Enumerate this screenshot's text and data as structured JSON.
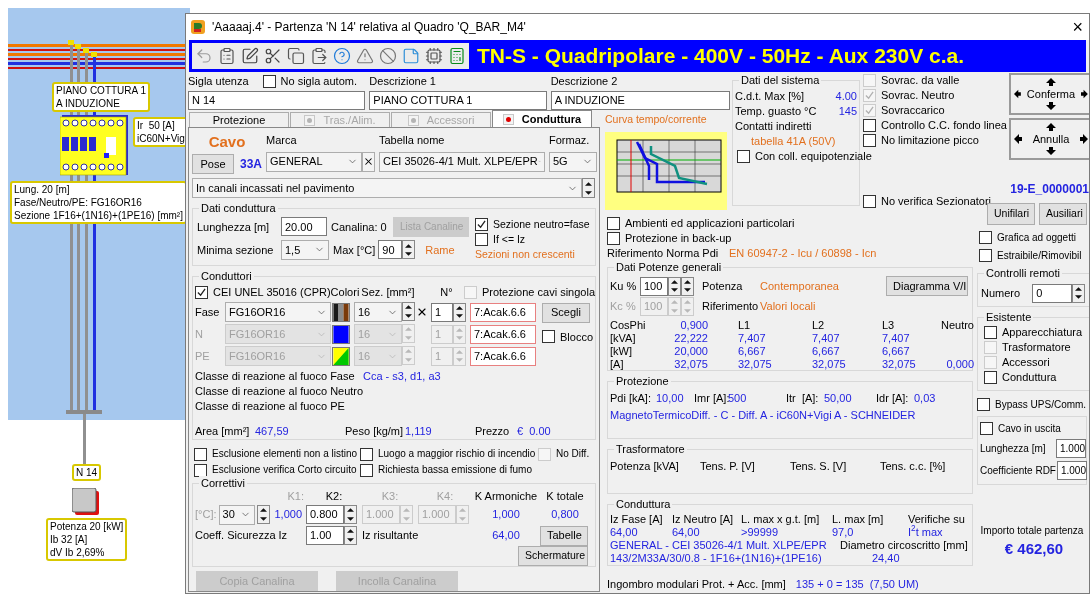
{
  "canvas": {
    "load_label": [
      "PIANO COTTURA 1",
      "A INDUZIONE"
    ],
    "breaker_label": [
      "Ir  50 [A]",
      "iC60N+Vig"
    ],
    "cable_label": [
      "Lung. 20 [m]",
      "Fase/Neutro/PE: FG16OR16",
      "Sezione 1F16+(1N16)+(1PE16) [mm²]"
    ],
    "node_label": "N 14",
    "load_info": [
      "Potenza 20 [kW]",
      "Ib 32 [A]",
      "dV Ib 2,69%"
    ]
  },
  "window": {
    "title": "'Aaaaaj.4' - Partenza 'N 14' relativa al Quadro 'Q_BAR_M4'",
    "close": "×"
  },
  "toolbar": {
    "banner": "TN-S - Quadripolare - 400V - 50Hz - Aux 230V c.a."
  },
  "header_fields": [
    {
      "label": "Sigla utenza",
      "value": "N 14",
      "checkbox": {
        "label": "No sigla autom.",
        "checked": false
      }
    },
    {
      "label": "Descrizione 1",
      "value": "PIANO COTTURA 1"
    },
    {
      "label": "Descrizione 2",
      "value": "A INDUZIONE"
    }
  ],
  "tabs": [
    {
      "label": "Protezione",
      "selected": false,
      "disabled": false
    },
    {
      "label": "Tras./Alim.",
      "selected": false,
      "disabled": true,
      "color": "#b4b4b4"
    },
    {
      "label": "Accessori",
      "selected": false,
      "disabled": true,
      "color": "#b4b4b4"
    },
    {
      "label": "Conduttura",
      "selected": true,
      "disabled": false,
      "color": "#e00000"
    }
  ],
  "cavo": {
    "title": "Cavo",
    "pose_button": "Pose",
    "current": "33A",
    "marca": {
      "label": "Marca",
      "value": "GENERAL"
    },
    "tabella": {
      "label": "Tabella nome",
      "value": "CEI 35026-4/1 Mult. XLPE/EPR"
    },
    "formaz": {
      "label": "Formaz.",
      "value": "5G"
    },
    "posa": "In canali incassati nel pavimento"
  },
  "dati_conduttura": {
    "title": "Dati conduttura",
    "lunghezza": {
      "label": "Lunghezza [m]",
      "value": "20.00"
    },
    "canalina": "Canalina: 0",
    "lista_button": {
      "label": "Lista Canaline",
      "disabled": true
    },
    "neutro_fase": {
      "label": "Sezione neutro=fase",
      "checked": true
    },
    "if_iz": {
      "label": "If <= Iz",
      "checked": false
    },
    "min_sezione": {
      "label": "Minima sezione",
      "value": "1,5"
    },
    "max_temp": {
      "label": "Max [°C]",
      "value": "90"
    },
    "material": "Rame",
    "warning": "Sezioni non crescenti"
  },
  "conduttori": {
    "title": "Conduttori",
    "cpr": {
      "label": "CEI UNEL 35016 (CPR)",
      "checked": true
    },
    "col_colori": "Colori",
    "col_sez": "Sez. [mm²]",
    "col_n": "N°",
    "protezione_singola": {
      "label": "Protezione cavi singola",
      "checked": false,
      "disabled": true
    },
    "rows": [
      {
        "label": "Fase",
        "cable": "FG16OR16",
        "sez": "16",
        "n": "1",
        "code": "7:Acak.6.6",
        "disabled": false,
        "clear": true,
        "stripes": [
          {
            "color": "#1a1a1a"
          },
          {
            "color": "#8c8c8c"
          },
          {
            "color": "#7a3a0a"
          }
        ]
      },
      {
        "label": "N",
        "cable": "FG16OR16",
        "sez": "16",
        "n": "1",
        "code": "7:Acak.6.6",
        "disabled": true,
        "clear": false,
        "stripes": [
          {
            "color": "#0000ff"
          }
        ]
      },
      {
        "label": "PE",
        "cable": "FG16OR16",
        "sez": "16",
        "n": "1",
        "code": "7:Acak.6.6",
        "disabled": true,
        "clear": false,
        "stripes": [
          {
            "color": "#ffff00"
          },
          {
            "color": "#00c800"
          }
        ]
      }
    ],
    "scegli": "Scegli",
    "blocco": {
      "label": "Blocco",
      "checked": false
    },
    "fire": [
      {
        "label": "Classe di reazione al fuoco Fase",
        "value": "Cca - s3, d1, a3"
      },
      {
        "label": "Classe di reazione al fuoco Neutro"
      },
      {
        "label": "Classe di reazione al fuoco PE"
      }
    ],
    "area": {
      "label": "Area [mm²]",
      "value": "467,59"
    },
    "peso": {
      "label": "Peso [kg/m]",
      "value": "1,119"
    },
    "prezzo": {
      "label": "Prezzo",
      "value": "€  0.00"
    }
  },
  "options": [
    {
      "label": "Esclusione elementi non a listino",
      "checked": false,
      "disabled": false
    },
    {
      "label": "Luogo a maggior rischio di incendio",
      "checked": false,
      "disabled": false
    },
    {
      "label": "No Diff.",
      "checked": false,
      "disabled": true
    },
    {
      "label": "Esclusione verifica Corto circuito",
      "checked": false,
      "disabled": false
    },
    {
      "label": "Richiesta bassa emissione di fumo",
      "checked": false,
      "disabled": false
    }
  ],
  "correttivi": {
    "title": "Correttivi",
    "temp_label": "[°C]:",
    "temp": "30",
    "k1": {
      "label": "K1:",
      "value": "1,000"
    },
    "k2": {
      "label": "K2:",
      "value": "0.800",
      "disabled": false
    },
    "k3": {
      "label": "K3:",
      "value": "1.000",
      "disabled": true
    },
    "k4": {
      "label": "K4:",
      "value": "1.000",
      "disabled": true
    },
    "k_armoniche": {
      "label": "K Armoniche",
      "value": "1,000"
    },
    "k_totale": {
      "label": "K totale",
      "value": "0,800"
    },
    "coeff": {
      "label": "Coeff. Sicurezza Iz",
      "value": "1.00"
    },
    "iz": {
      "label": "Iz risultante",
      "value": "64,00"
    },
    "tabelle": "Tabelle",
    "schermature": "Schermature"
  },
  "bottom_buttons": [
    {
      "label": "Copia Canalina",
      "disabled": true
    },
    {
      "label": "Incolla Canalina",
      "disabled": true
    }
  ],
  "curve": {
    "title": "Curva tempo/corrente"
  },
  "sistema": {
    "title": "Dati del sistema",
    "rows": [
      {
        "label": "C.d.t. Max [%]",
        "value": "4.00"
      },
      {
        "label": "Temp. guasto °C",
        "value": "145"
      }
    ],
    "contatti": "Contatti indiretti",
    "tabella": "tabella 41A (50V)",
    "equipotenziale": {
      "label": "Con coll. equipotenziale",
      "checked": false
    }
  },
  "flags": [
    {
      "label": "Sovrac. da valle",
      "checked": false,
      "disabled": true
    },
    {
      "label": "Sovrac. Neutro",
      "checked": true,
      "disabled": true
    },
    {
      "label": "Sovraccarico",
      "checked": true,
      "disabled": true
    },
    {
      "label": "Controllo C.C. fondo linea",
      "checked": false,
      "disabled": false
    },
    {
      "label": "No limitazione picco",
      "checked": false,
      "disabled": false
    }
  ],
  "no_verifica": {
    "label": "No verifica Sezionatori",
    "checked": false
  },
  "ambienti": [
    {
      "label": "Ambienti ed applicazioni particolari",
      "checked": false
    },
    {
      "label": "Protezione in back-up",
      "checked": false
    }
  ],
  "norma": {
    "label": "Riferimento Norma Pdi",
    "value": "EN 60947-2 - Icu / 60898 - Icn"
  },
  "potenze": {
    "title": "Dati Potenze generali",
    "ku": {
      "label": "Ku %",
      "value": "100",
      "disabled": false
    },
    "kc": {
      "label": "Kc %",
      "value": "100",
      "disabled": true
    },
    "potenza": {
      "label": "Potenza",
      "value": "Contemporanea"
    },
    "riferimento": {
      "label": "Riferimento",
      "value": "Valori locali"
    },
    "diagram_button": "Diagramma V/I",
    "header": {
      "label": "CosPhi",
      "value": "0,900",
      "columns": [
        "L1",
        "L2",
        "L3",
        "Neutro"
      ]
    },
    "rows": [
      {
        "label": "[kVA]",
        "values": [
          "22,222",
          "7,407",
          "7,407",
          "7,407"
        ]
      },
      {
        "label": "[kW]",
        "values": [
          "20,000",
          "6,667",
          "6,667",
          "6,667"
        ]
      },
      {
        "label": "[A]",
        "values": [
          "32,075",
          "32,075",
          "32,075",
          "32,075",
          "0,000"
        ]
      }
    ]
  },
  "protezione": {
    "title": "Protezione",
    "values": [
      {
        "label": "Pdi [kA]:",
        "value": "10,00"
      },
      {
        "label": "Imr [A]:",
        "value": "500"
      },
      {
        "label": "Itr  [A]:",
        "value": "50,00"
      },
      {
        "label": "Idr [A]:",
        "value": "0,03"
      }
    ],
    "description": "MagnetoTermicoDiff. - C - Diff. A - iC60N+Vigi A - SCHNEIDER"
  },
  "trasformatore": {
    "title": "Trasformatore",
    "columns": [
      "Potenza [kVA]",
      "Tens. P. [V]",
      "Tens. S. [V]",
      "Tens. c.c. [%]"
    ]
  },
  "conduttura": {
    "title": "Conduttura",
    "columns": [
      {
        "label": "Iz Fase [A]",
        "value": "64,00"
      },
      {
        "label": "Iz Neutro [A]",
        "value": "64,00"
      },
      {
        "label": "L. max x g.t. [m]",
        "value": ">99999"
      },
      {
        "label": "L. max [m]",
        "value": "97,0"
      },
      {
        "label": "Verifiche su",
        "value": "I$^{2}$t max"
      }
    ],
    "cable": "GENERAL - CEI 35026-4/1 Mult. XLPE/EPR",
    "code": "143/2M33A/30/0.8 - 1F16+(1N16)+(1PE16)",
    "diametro": {
      "label": "Diametro circoscritto [mm]",
      "value": "24,40"
    }
  },
  "ingombro": {
    "label": "Ingombro modulari Prot. + Acc. [mm]",
    "value": "135 + 0 = 135  (7,50 UM)"
  },
  "side": {
    "conferma": "Conferma",
    "annulla": "Annulla",
    "code": "19-E_0000001",
    "buttons": [
      "Unifilari",
      "Ausiliari"
    ],
    "checks": [
      {
        "label": "Grafica ad oggetti",
        "checked": false
      },
      {
        "label": "Estraibile/Rimovibil",
        "checked": false
      }
    ],
    "remote": {
      "title": "Controlli remoti",
      "label": "Numero",
      "value": "0"
    },
    "esistente": {
      "title": "Esistente",
      "items": [
        {
          "label": "Apparecchiatura",
          "checked": false,
          "disabled": false
        },
        {
          "label": "Trasformatore",
          "checked": false,
          "disabled": true
        },
        {
          "label": "Accessori",
          "checked": false,
          "disabled": true
        },
        {
          "label": "Conduttura",
          "checked": false,
          "disabled": false
        }
      ]
    },
    "bypass": {
      "label": "Bypass UPS/Comm.",
      "checked": false
    },
    "uscita": {
      "checkbox": {
        "label": "Cavo in uscita",
        "checked": false
      },
      "fields": [
        {
          "label": "Lunghezza [m]",
          "value": "1.000"
        },
        {
          "label": "Coefficiente RDF",
          "value": "1.000"
        }
      ]
    },
    "total": {
      "label": "Importo totale partenza",
      "value": "€ 462,60"
    }
  }
}
